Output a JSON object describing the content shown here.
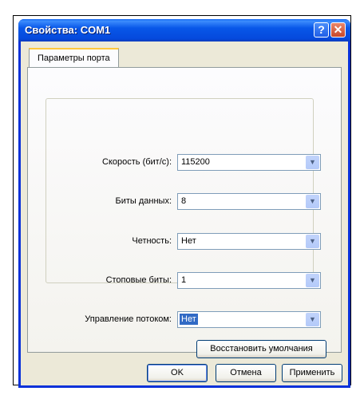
{
  "window": {
    "title": "Свойства: COM1",
    "help_symbol": "?",
    "close_symbol": "✕"
  },
  "tabs": [
    {
      "label": "Параметры порта"
    }
  ],
  "fields": [
    {
      "label": "Скорость (бит/с):",
      "value": "115200"
    },
    {
      "label": "Биты данных:",
      "value": "8"
    },
    {
      "label": "Четность:",
      "value": "Нет"
    },
    {
      "label": "Стоповые биты:",
      "value": "1"
    },
    {
      "label": "Управление потоком:",
      "value": "Нет"
    }
  ],
  "buttons": {
    "restore_defaults": "Восстановить умолчания",
    "ok": "OK",
    "cancel": "Отмена",
    "apply": "Применить"
  },
  "dropdown_arrow": "▼"
}
